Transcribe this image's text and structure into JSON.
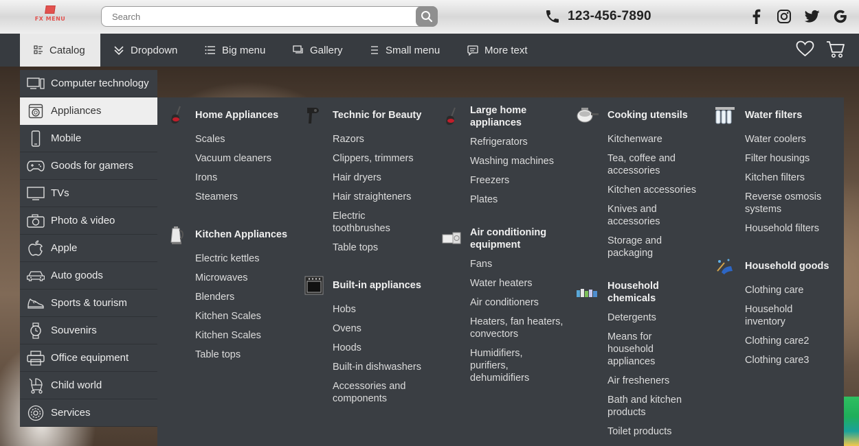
{
  "brand": {
    "logo_text": "FX MENU"
  },
  "search": {
    "placeholder": "Search"
  },
  "contact": {
    "phone": "123-456-7890"
  },
  "social": [
    "facebook-icon",
    "instagram-icon",
    "twitter-icon",
    "google-icon"
  ],
  "nav": {
    "items": [
      {
        "label": "Catalog",
        "icon": "grid-list-icon",
        "active": true
      },
      {
        "label": "Dropdown",
        "icon": "chevron-double-down-icon"
      },
      {
        "label": "Big menu",
        "icon": "list-icon"
      },
      {
        "label": "Gallery",
        "icon": "gallery-icon"
      },
      {
        "label": "Small menu",
        "icon": "menu-lines-icon"
      },
      {
        "label": "More text",
        "icon": "chat-icon"
      }
    ]
  },
  "catalog": {
    "items": [
      {
        "label": "Computer technology",
        "icon": "computer-icon"
      },
      {
        "label": "Appliances",
        "icon": "washing-machine-icon",
        "active": true
      },
      {
        "label": "Mobile",
        "icon": "mobile-phone-icon"
      },
      {
        "label": "Goods for gamers",
        "icon": "gamepad-icon"
      },
      {
        "label": "TVs",
        "icon": "tv-icon"
      },
      {
        "label": "Photo & video",
        "icon": "camera-icon"
      },
      {
        "label": "Apple",
        "icon": "apple-icon"
      },
      {
        "label": "Auto goods",
        "icon": "car-icon"
      },
      {
        "label": "Sports & tourism",
        "icon": "sneaker-icon"
      },
      {
        "label": "Souvenirs",
        "icon": "watch-icon"
      },
      {
        "label": "Office equipment",
        "icon": "printer-icon"
      },
      {
        "label": "Child world",
        "icon": "stroller-icon"
      },
      {
        "label": "Services",
        "icon": "gear-icon"
      }
    ]
  },
  "mega": {
    "col1": {
      "g1": {
        "title": "Home Appliances",
        "icon": "vacuum-cleaner-icon",
        "links": [
          "Scales",
          "Vacuum cleaners",
          "Irons",
          "Steamers"
        ]
      },
      "g2": {
        "title": "Kitchen Appliances",
        "icon": "kettle-icon",
        "links": [
          "Electric kettles",
          "Microwaves",
          "Blenders",
          "Kitchen Scales",
          "Kitchen Scales",
          "Table tops"
        ]
      }
    },
    "col2": {
      "g1": {
        "title": "Technic for Beauty",
        "icon": "hair-dryer-icon",
        "links": [
          "Razors",
          "Clippers, trimmers",
          "Hair dryers",
          "Hair straighteners",
          "Electric toothbrushes",
          "Table tops"
        ]
      },
      "g2": {
        "title": "Built-in appliances",
        "icon": "oven-icon",
        "links": [
          "Hobs",
          "Ovens",
          "Hoods",
          "Built-in dishwashers",
          "Accessories and components"
        ]
      }
    },
    "col3": {
      "g1": {
        "title": "Large home appliances",
        "icon": "vacuum-cleaner-icon",
        "links": [
          "Refrigerators",
          "Washing machines",
          "Freezers",
          "Plates"
        ]
      },
      "g2": {
        "title": "Air conditioning equipment",
        "icon": "air-conditioner-icon",
        "links": [
          "Fans",
          "Water heaters",
          "Air conditioners",
          "Heaters, fan heaters, convectors",
          "Humidifiers, purifiers, dehumidifiers"
        ]
      }
    },
    "col4": {
      "g1": {
        "title": "Cooking utensils",
        "icon": "cookware-icon",
        "links": [
          "Kitchenware",
          "Tea, coffee and accessories",
          "Kitchen accessories",
          "Knives and accessories",
          "Storage and packaging"
        ]
      },
      "g2": {
        "title": "Household chemicals",
        "icon": "chemicals-icon",
        "links": [
          "Detergents",
          "Means for household appliances",
          "Air fresheners",
          "Bath and kitchen products",
          "Toilet products"
        ]
      }
    },
    "col5": {
      "g1": {
        "title": "Water filters",
        "icon": "water-filter-icon",
        "links": [
          "Water coolers",
          "Filter housings",
          "Kitchen filters",
          "Reverse osmosis systems",
          "Household filters"
        ]
      },
      "g2": {
        "title": "Household goods",
        "icon": "household-goods-icon",
        "links": [
          "Clothing care",
          "Household inventory",
          "Clothing care2",
          "Clothing care3"
        ]
      }
    }
  }
}
